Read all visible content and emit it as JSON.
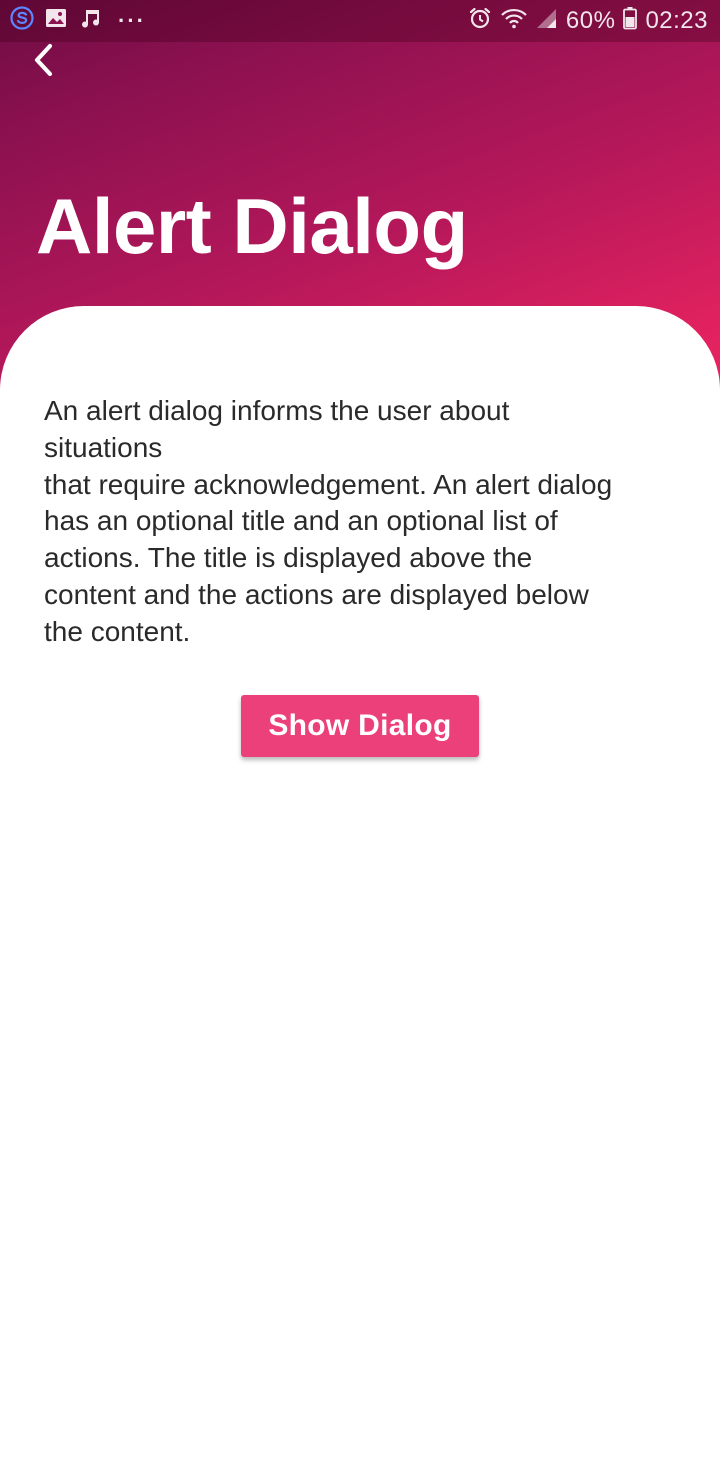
{
  "status_bar": {
    "battery_percent": "60%",
    "time": "02:23",
    "overflow": "···"
  },
  "icons": {
    "status_left": [
      "app-s-icon",
      "image-icon",
      "music-note-icon",
      "more-dots-icon"
    ],
    "status_right": [
      "alarm-icon",
      "wifi-icon",
      "signal-icon",
      "battery-icon"
    ],
    "navigation": "back-arrow-icon"
  },
  "header": {
    "title": "Alert Dialog"
  },
  "content": {
    "description": "An alert dialog informs the user about\nsituations\nthat require acknowledgement. An alert dialog\nhas an optional title and an optional list of\nactions. The title is displayed above the\ncontent and the actions are displayed below\nthe content.",
    "button_label": "Show Dialog"
  },
  "colors": {
    "header_gradient_start": "#6e0c44",
    "header_gradient_end": "#ee2363",
    "button": "#ec407a",
    "text": "#2a2a2a"
  }
}
